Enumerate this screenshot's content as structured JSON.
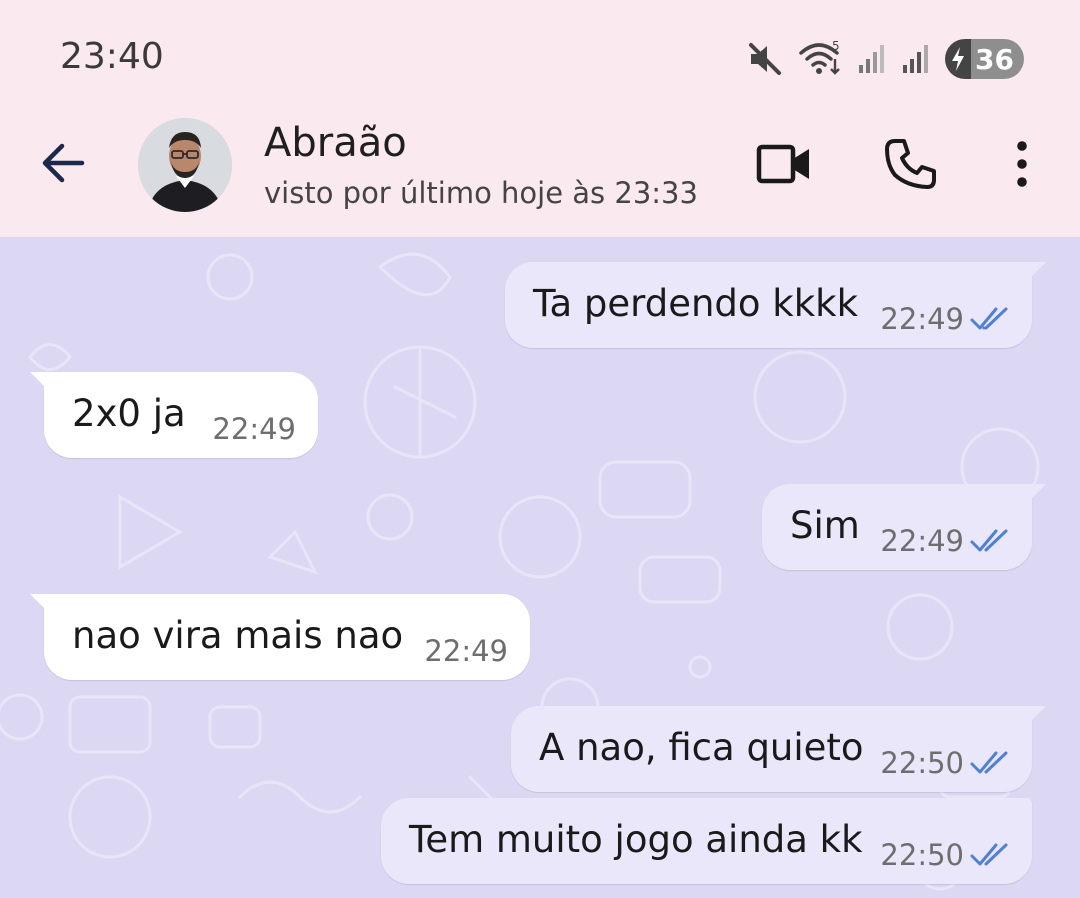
{
  "status_bar": {
    "time": "23:40",
    "icons": [
      "mute-icon",
      "wifi-icon",
      "signal-icon",
      "signal-icon"
    ],
    "battery": "36",
    "network_label": "5"
  },
  "header": {
    "back_icon": "arrow-left-icon",
    "contact_name": "Abraão",
    "last_seen": "visto por último hoje às 23:33",
    "actions": [
      "video-call-icon",
      "phone-icon",
      "more-vertical-icon"
    ]
  },
  "colors": {
    "header_bg": "#fbe9f0",
    "chat_bg": "#dcd8f3",
    "outgoing_bubble": "#ebe7fb",
    "incoming_bubble": "#ffffff",
    "read_ticks": "#4f80d8"
  },
  "messages": [
    {
      "direction": "out",
      "text": "Ta perdendo kkkk",
      "time": "22:49",
      "ticks": "double-check-icon"
    },
    {
      "direction": "in",
      "text": "2x0 ja",
      "time": "22:49"
    },
    {
      "direction": "out",
      "text": "Sim",
      "time": "22:49",
      "ticks": "double-check-icon"
    },
    {
      "direction": "in",
      "text": "nao vira mais nao",
      "time": "22:49"
    },
    {
      "direction": "out",
      "text": "A nao, fica quieto",
      "time": "22:50",
      "ticks": "double-check-icon"
    },
    {
      "direction": "out",
      "text": "Tem muito jogo ainda kk",
      "time": "22:50",
      "ticks": "double-check-icon"
    }
  ]
}
